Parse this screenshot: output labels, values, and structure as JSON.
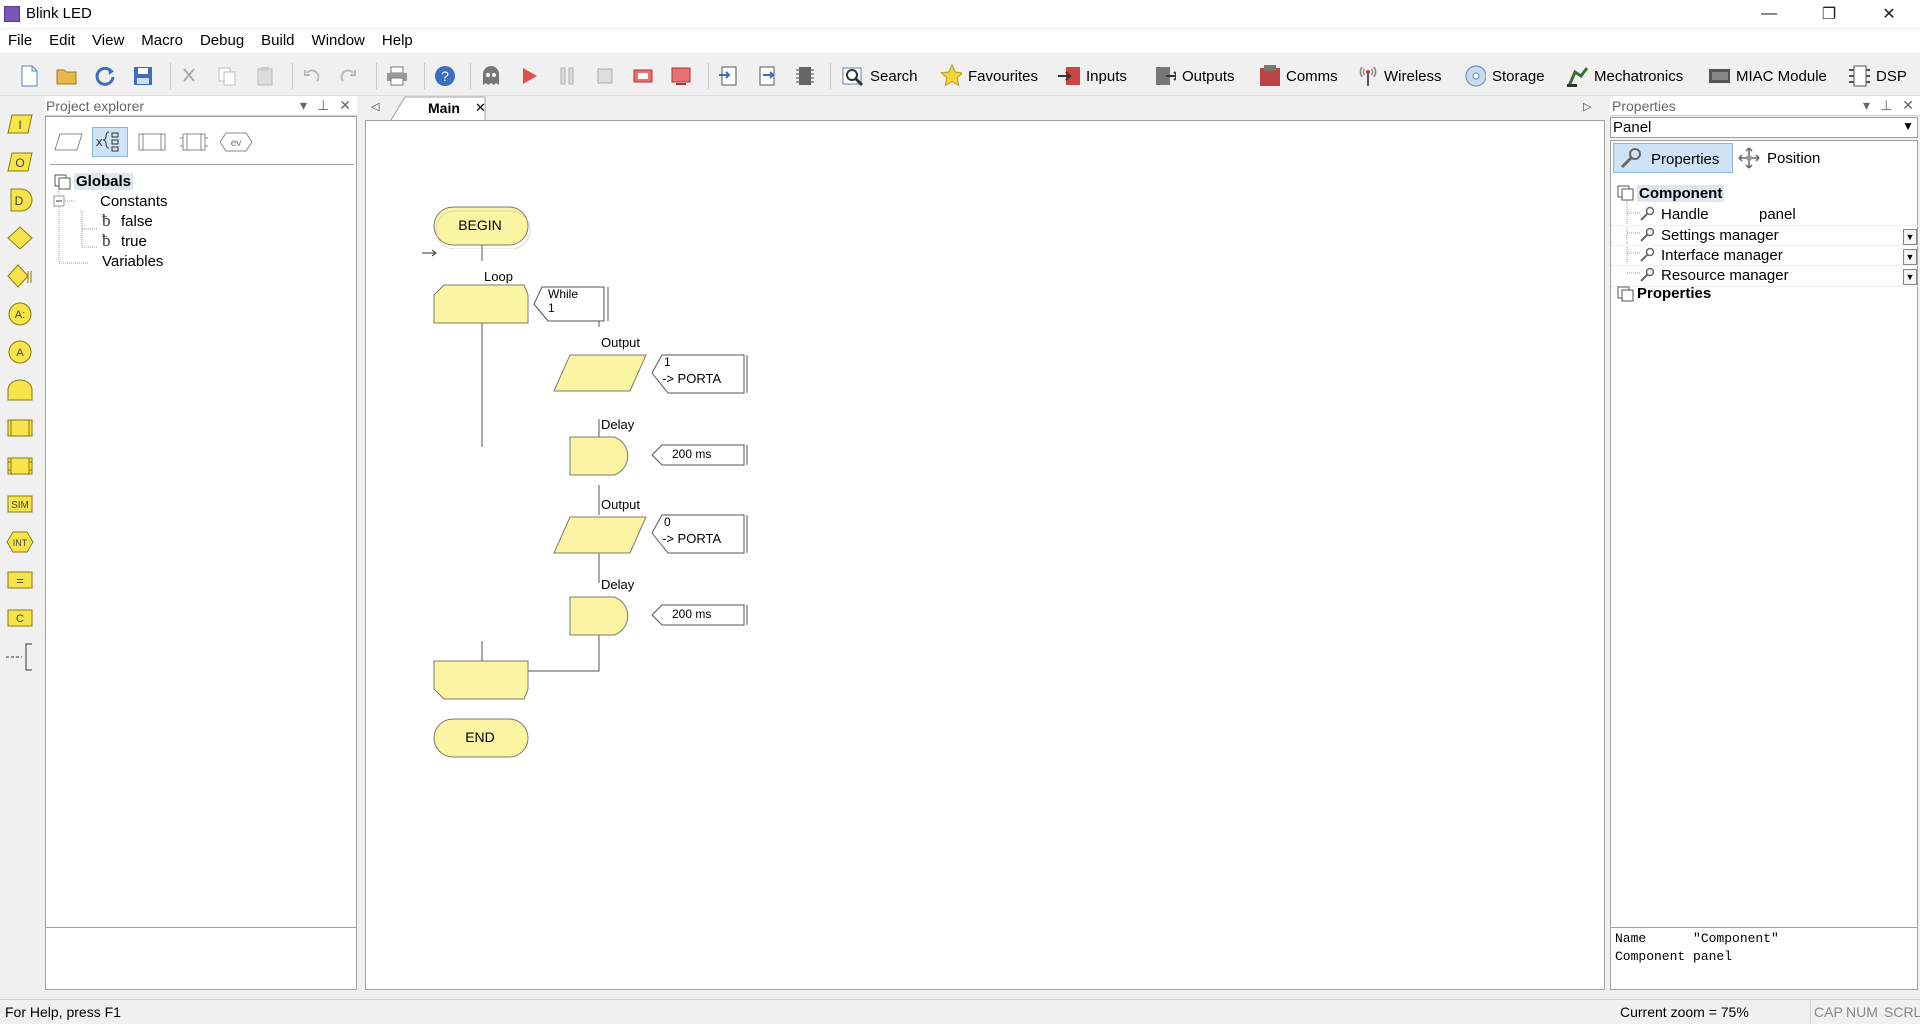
{
  "window": {
    "title": "Blink LED",
    "minimize": "—",
    "maximize": "❐",
    "close": "✕"
  },
  "menu": [
    "File",
    "Edit",
    "View",
    "Macro",
    "Debug",
    "Build",
    "Window",
    "Help"
  ],
  "toolbar": {
    "buttons": [
      "Search",
      "Favourites",
      "Inputs",
      "Outputs",
      "Comms",
      "Wireless",
      "Storage",
      "Mechatronics",
      "MIAC Module",
      "DSP"
    ]
  },
  "palette": [
    "I",
    "O",
    "D",
    "",
    "",
    "A:",
    "A",
    "",
    "",
    "",
    "SIM",
    "INT",
    "=",
    "C",
    "--["
  ],
  "project_explorer": {
    "title": "Project explorer",
    "tabs_icons": [
      "ev"
    ],
    "tree": {
      "root": "Globals",
      "constants_label": "Constants",
      "constants": [
        "false",
        "true"
      ],
      "variables_label": "Variables"
    }
  },
  "document": {
    "tab": "Main",
    "flowchart": {
      "begin": "BEGIN",
      "end": "END",
      "loop_label": "Loop",
      "loop_cond_1": "While",
      "loop_cond_2": "1",
      "steps": [
        {
          "type": "Output",
          "line1": "1",
          "line2": "-> PORTA"
        },
        {
          "type": "Delay",
          "value": "200 ms"
        },
        {
          "type": "Output",
          "line1": "0",
          "line2": "-> PORTA"
        },
        {
          "type": "Delay",
          "value": "200 ms"
        }
      ]
    }
  },
  "properties": {
    "title": "Properties",
    "selector": "Panel",
    "tab_properties": "Properties",
    "tab_position": "Position",
    "section_component": "Component",
    "rows": [
      {
        "name": "Handle",
        "value": "panel"
      },
      {
        "name": "Settings manager",
        "value": ""
      },
      {
        "name": "Interface manager",
        "value": ""
      },
      {
        "name": "Resource manager",
        "value": ""
      }
    ],
    "section_properties": "Properties",
    "info_line1": "Name      \"Component\"",
    "info_line2": "Component panel"
  },
  "status": {
    "help": "For Help, press F1",
    "zoom": "Current zoom = 75%",
    "cap": "CAP",
    "num": "NUM",
    "scrl": "SCRL"
  },
  "colors": {
    "flow_fill": "#fbf5a3",
    "flow_stroke": "#7a7a6a",
    "icon_yellow": "#f7e34a"
  }
}
